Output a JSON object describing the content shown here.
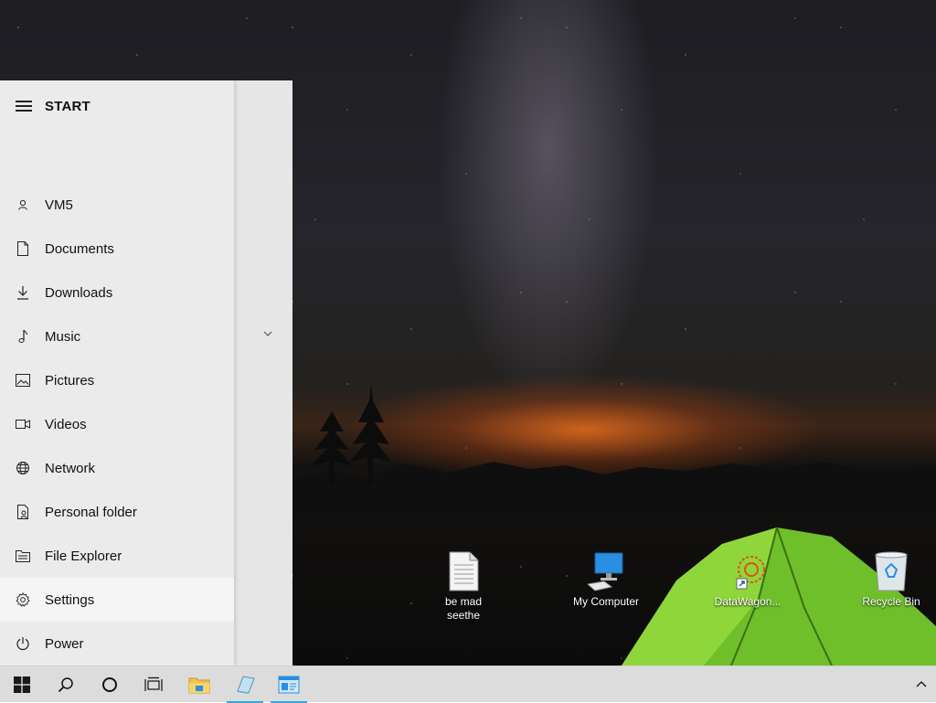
{
  "start_menu": {
    "title": "START",
    "items": [
      {
        "label": "VM5",
        "icon": "user-icon"
      },
      {
        "label": "Documents",
        "icon": "document-icon"
      },
      {
        "label": "Downloads",
        "icon": "download-icon"
      },
      {
        "label": "Music",
        "icon": "music-note-icon"
      },
      {
        "label": "Pictures",
        "icon": "pictures-icon"
      },
      {
        "label": "Videos",
        "icon": "video-camera-icon"
      },
      {
        "label": "Network",
        "icon": "network-globe-icon"
      },
      {
        "label": "Personal folder",
        "icon": "personal-folder-icon"
      },
      {
        "label": "File Explorer",
        "icon": "file-explorer-icon"
      },
      {
        "label": "Settings",
        "icon": "gear-icon"
      },
      {
        "label": "Power",
        "icon": "power-icon"
      }
    ]
  },
  "desktop": {
    "icons": [
      {
        "label": "be mad seethe",
        "icon": "text-file-icon"
      },
      {
        "label": "My Computer",
        "icon": "computer-icon"
      },
      {
        "label": "DataWagon...",
        "icon": "shortcut-app-icon"
      },
      {
        "label": "Recycle Bin",
        "icon": "recycle-bin-icon"
      }
    ]
  },
  "taskbar": {
    "items": [
      "windows-start-icon",
      "search-icon",
      "cortana-icon",
      "task-view-icon",
      "file-explorer-folder-icon",
      "app-notebook-icon",
      "app-window-icon"
    ],
    "accent_color": "#3aa6d8"
  }
}
